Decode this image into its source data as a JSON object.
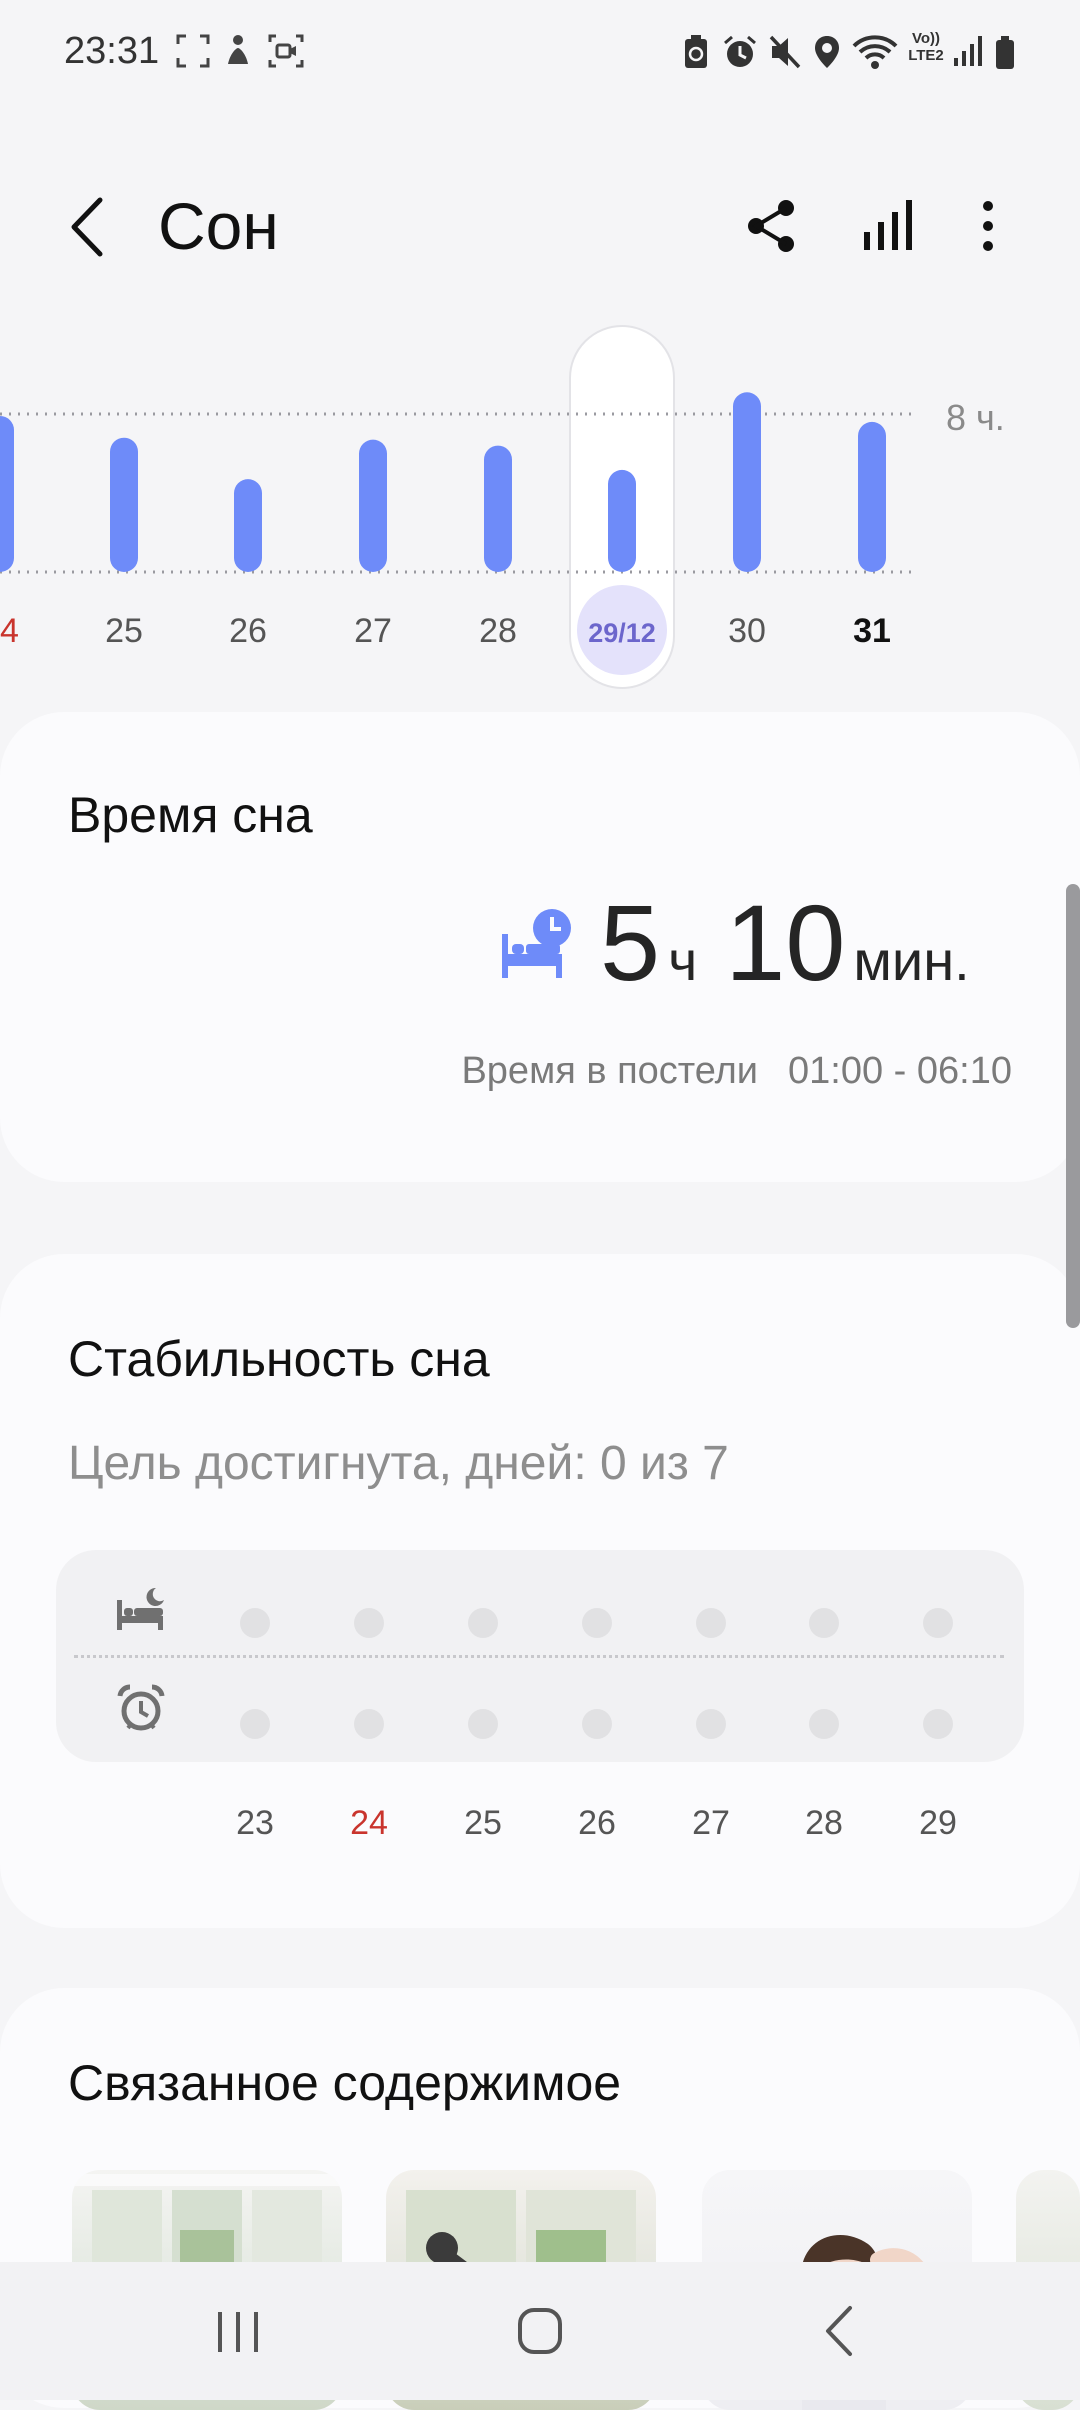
{
  "status_bar": {
    "time": "23:31",
    "left_icons": [
      "screenshot-icon",
      "accessibility-icon",
      "screen-record-icon"
    ],
    "right_icons": [
      "battery-saver-icon",
      "alarm-icon",
      "mute-icon",
      "location-icon",
      "wifi-icon",
      "volte-icon",
      "signal-icon",
      "battery-icon"
    ],
    "volte_label": "Vo)) LTE2"
  },
  "header": {
    "title": "Сон",
    "actions": [
      "share-icon",
      "stats-icon",
      "more-icon"
    ]
  },
  "chart_data": {
    "type": "bar",
    "categories": [
      "24",
      "25",
      "26",
      "27",
      "28",
      "29/12",
      "30",
      "31"
    ],
    "values": [
      7.9,
      6.8,
      4.7,
      6.7,
      6.4,
      5.17,
      9.1,
      7.6
    ],
    "reference_line": {
      "value": 8,
      "label": "8 ч."
    },
    "selected_index": 5,
    "bold_index": 7,
    "red_index": 0,
    "bar_color": "#6e8bf9",
    "selected_color": "#e4e2fb",
    "selected_text_color": "#6c66cc",
    "red_color": "#c9342d"
  },
  "sleep_time": {
    "title": "Время сна",
    "hours": "5",
    "hours_unit": "ч",
    "minutes": "10",
    "minutes_unit": "мин.",
    "in_bed_label": "Время в постели",
    "in_bed_range": "01:00 - 06:10",
    "icon": "bed-clock-icon",
    "accent": "#6e8bf9"
  },
  "consistency": {
    "title": "Стабильность сна",
    "subtitle": "Цель достигнута, дней: 0 из 7",
    "row_icons": [
      "bedtime-icon",
      "alarm-wake-icon"
    ],
    "days": [
      {
        "label": "23",
        "red": false
      },
      {
        "label": "24",
        "red": true
      },
      {
        "label": "25",
        "red": false
      },
      {
        "label": "26",
        "red": false
      },
      {
        "label": "27",
        "red": false
      },
      {
        "label": "28",
        "red": false
      },
      {
        "label": "29",
        "red": false
      }
    ]
  },
  "related": {
    "title": "Связанное содержимое",
    "items": [
      "yoga-room-thumbnail",
      "stretching-thumbnail",
      "woman-stretching-thumbnail",
      "partial-thumbnail"
    ]
  },
  "nav_bar": {
    "buttons": [
      "recent-apps-icon",
      "home-icon",
      "back-icon"
    ]
  }
}
